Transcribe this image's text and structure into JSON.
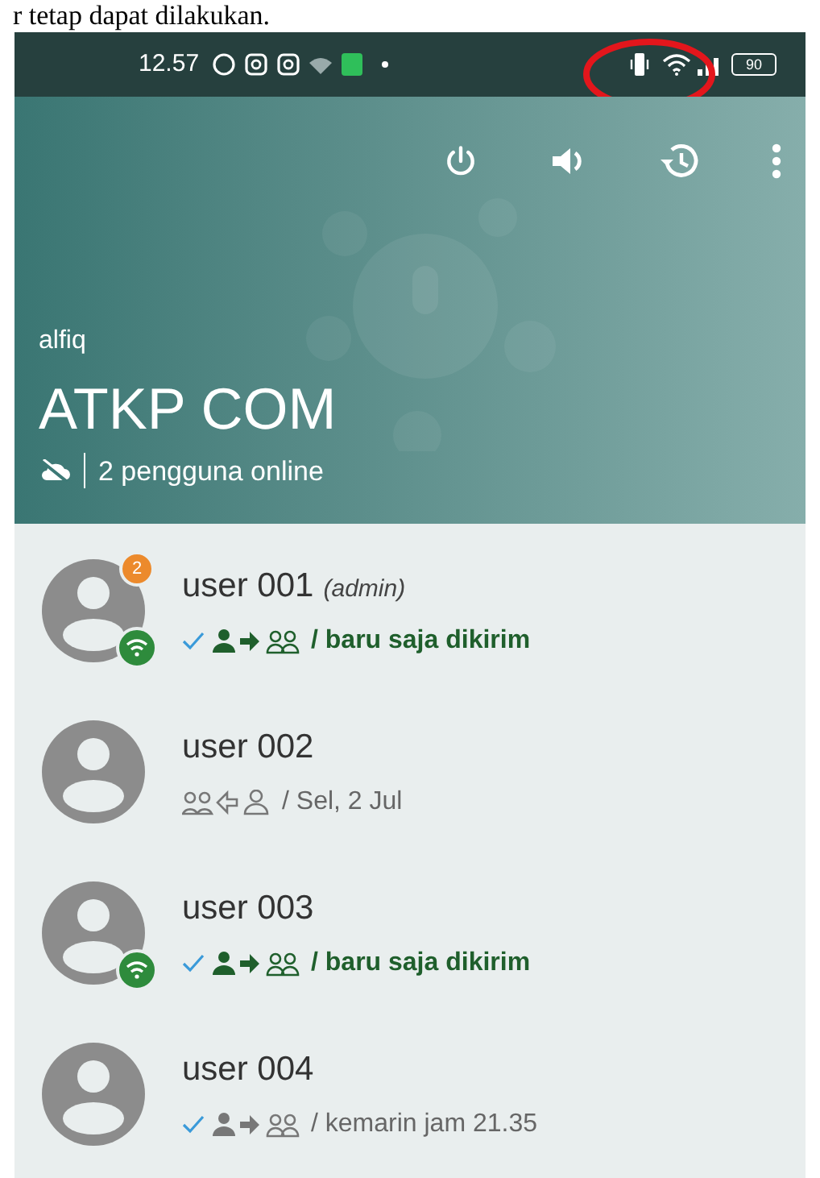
{
  "document_text": "r tetap dapat dilakukan.",
  "status_bar": {
    "time": "12.57",
    "battery": "90"
  },
  "header": {
    "user": "alfiq",
    "title": "ATKP COM",
    "online_text": "2 pengguna online"
  },
  "users": [
    {
      "name": "user 001",
      "role": "(admin)",
      "unread": "2",
      "online": true,
      "kind": "sent",
      "recent": true,
      "message": "/ baru saja dikirim"
    },
    {
      "name": "user 002",
      "online": false,
      "kind": "received",
      "recent": false,
      "message": "/ Sel, 2 Jul"
    },
    {
      "name": "user 003",
      "online": true,
      "kind": "sent",
      "recent": true,
      "message": "/ baru saja dikirim"
    },
    {
      "name": "user 004",
      "online": false,
      "kind": "sent",
      "recent": false,
      "message": "/ kemarin jam 21.35"
    }
  ]
}
